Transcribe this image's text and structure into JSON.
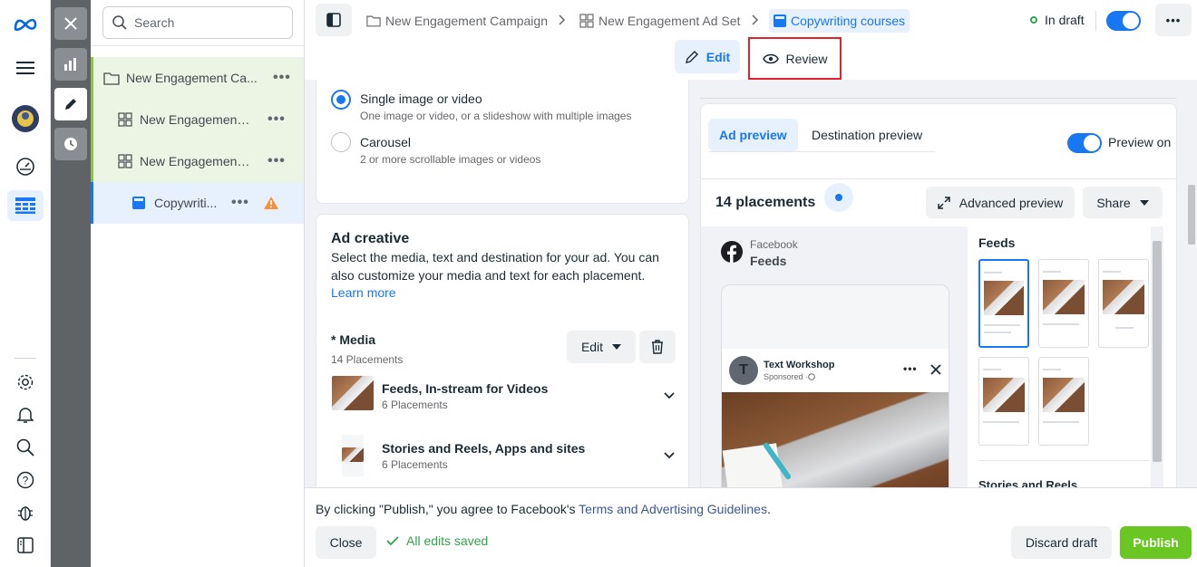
{
  "rail": {
    "icons": [
      "meta-logo-icon",
      "menu-icon",
      "avatar",
      "dashboard-icon",
      "table-icon",
      "settings-icon",
      "bell-icon",
      "search-icon",
      "help-icon",
      "bug-icon",
      "panel-icon"
    ]
  },
  "tree": {
    "search_placeholder": "Search",
    "campaign": "New Engagement Ca...",
    "adset1": "New Engagement ...",
    "adset2": "New Engagement ...",
    "ad": "Copywriti..."
  },
  "topbar": {
    "crumbs": [
      "New Engagement Campaign",
      "New Engagement Ad Set",
      "Copywriting courses"
    ],
    "status": "In draft"
  },
  "modes": {
    "edit": "Edit",
    "review": "Review"
  },
  "format": {
    "single_title": "Single image or video",
    "single_desc": "One image or video, or a slideshow with multiple images",
    "carousel_title": "Carousel",
    "carousel_desc": "2 or more scrollable images or videos"
  },
  "creative": {
    "title": "Ad creative",
    "desc": "Select the media, text and destination for your ad. You can also customize your media and text for each placement.",
    "learn_more": "Learn more",
    "media_label": "* Media",
    "media_count": "14 Placements",
    "edit_label": "Edit",
    "groups": [
      {
        "title": "Feeds, In-stream for Videos",
        "count": "6 Placements"
      },
      {
        "title": "Stories and Reels, Apps and sites",
        "count": "6 Placements"
      }
    ]
  },
  "preview": {
    "tab_ad": "Ad preview",
    "tab_dest": "Destination preview",
    "preview_on": "Preview on",
    "placements": "14 placements",
    "advanced": "Advanced preview",
    "share": "Share",
    "platform": "Facebook",
    "placement_name": "Feeds",
    "page_name": "Text Workshop",
    "sponsored": "Sponsored · ",
    "page_initial": "T",
    "side_feeds": "Feeds",
    "side_stories": "Stories and Reels"
  },
  "bottom": {
    "terms_prefix": "By clicking \"Publish,\" you agree to Facebook's ",
    "terms_link": "Terms and Advertising Guidelines",
    "terms_suffix": ".",
    "close": "Close",
    "saved": "All edits saved",
    "discard": "Discard draft",
    "publish": "Publish"
  },
  "colors": {
    "accent": "#1877f2",
    "publish": "#69c623",
    "review_outline": "#e0232e",
    "saved": "#31a24c"
  }
}
